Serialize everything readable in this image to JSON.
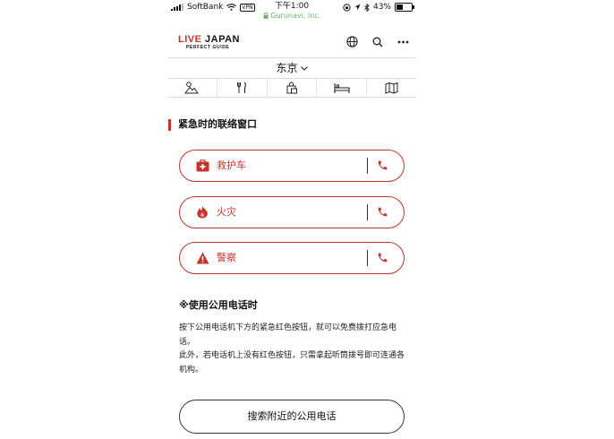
{
  "status_bar": {
    "carrier": "SoftBank",
    "vpn": "VPN",
    "time": "下午1:00",
    "url": "Gurunavi, Inc.",
    "battery": "43%",
    "battery_level": 0.43
  },
  "header": {
    "logo_live": "LIVE",
    "logo_japan": "JAPAN",
    "logo_sub": "PERFECT GUIDE",
    "icons": [
      "globe-icon",
      "search-icon",
      "more-icon"
    ]
  },
  "city": {
    "name": "东京"
  },
  "categories": [
    "sightseeing-icon",
    "dining-icon",
    "shopping-icon",
    "hotel-icon",
    "map-icon"
  ],
  "section": {
    "title": "紧急时的联络窗口"
  },
  "emergency": [
    {
      "label": "救护车",
      "icon": "ambulance-icon"
    },
    {
      "label": "火灾",
      "icon": "fire-icon"
    },
    {
      "label": "警察",
      "icon": "warning-icon"
    }
  ],
  "notes": {
    "title": "※使用公用电话时",
    "para1": "按下公用电话机下方的紧急红色按钮，就可以免费拨打应急电话。",
    "para2": "此外，若电话机上没有红色按钮，只需拿起听筒拨号即可连通各机构。"
  },
  "search_button": "搜索附近的公用电话",
  "colors": {
    "accent": "#c8332c",
    "url_green": "#6bb46b"
  }
}
